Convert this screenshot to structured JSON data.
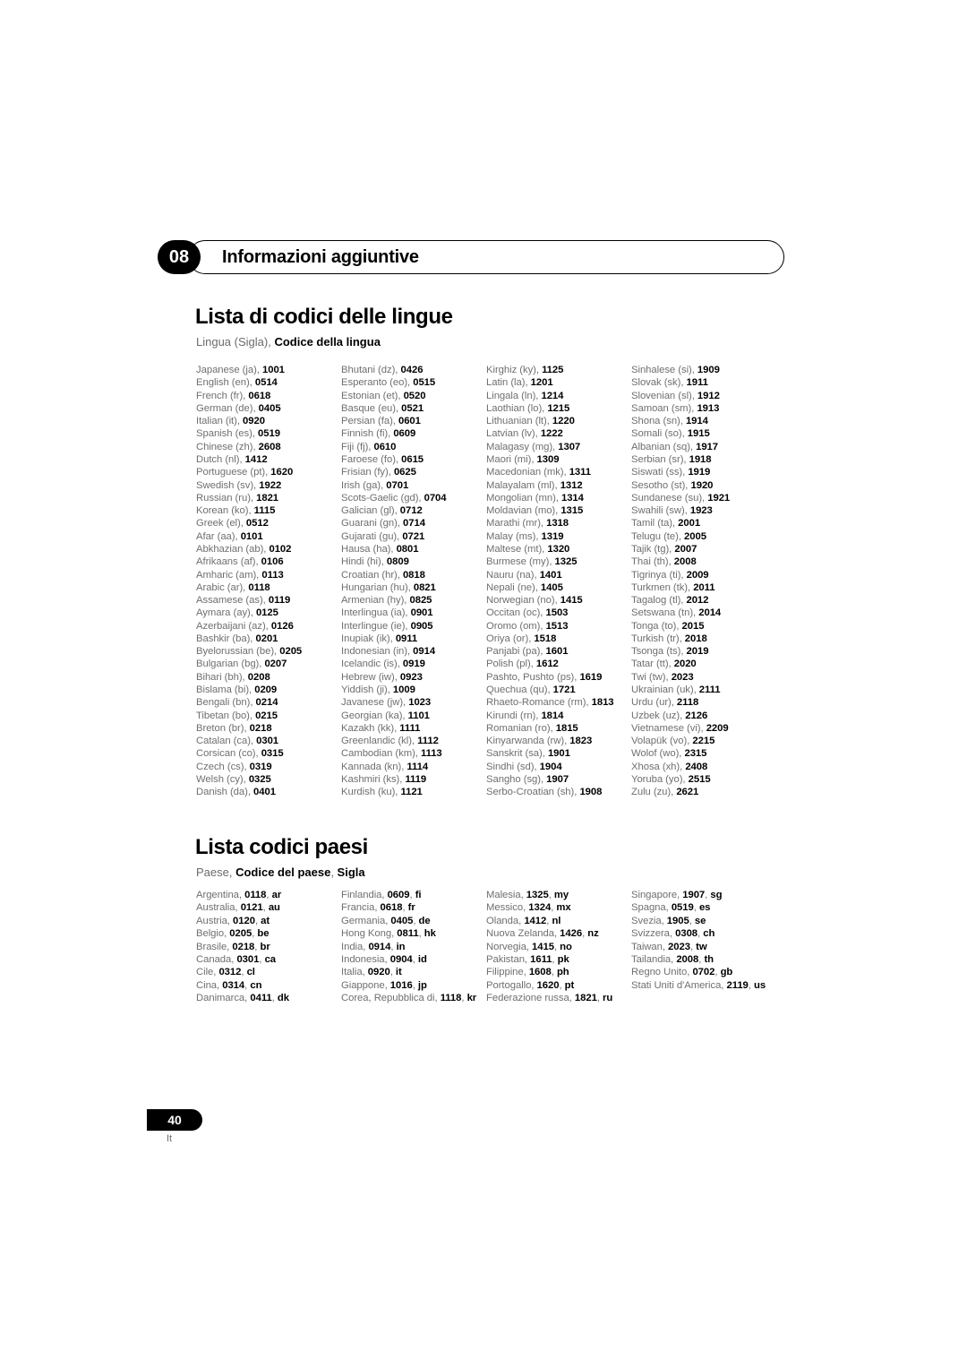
{
  "chapter": {
    "number": "08",
    "title": "Informazioni aggiuntive"
  },
  "language_section": {
    "title": "Lista di codici delle lingue",
    "subtitle_plain": "Lingua (Sigla), ",
    "subtitle_bold": "Codice della lingua"
  },
  "country_section": {
    "title": "Lista codici paesi",
    "subtitle_plain": "Paese, ",
    "subtitle_bold1": "Codice del paese",
    "subtitle_plain2": ", ",
    "subtitle_bold2": "Sigla"
  },
  "language_codes": {
    "columns": [
      [
        {
          "name": "Japanese (ja), ",
          "code": "1001"
        },
        {
          "name": "English (en), ",
          "code": "0514"
        },
        {
          "name": "French (fr), ",
          "code": "0618"
        },
        {
          "name": "German (de), ",
          "code": "0405"
        },
        {
          "name": "Italian (it), ",
          "code": "0920"
        },
        {
          "name": "Spanish (es), ",
          "code": "0519"
        },
        {
          "name": "Chinese (zh), ",
          "code": "2608"
        },
        {
          "name": "Dutch (nl), ",
          "code": "1412"
        },
        {
          "name": "Portuguese (pt), ",
          "code": "1620"
        },
        {
          "name": "Swedish (sv), ",
          "code": "1922"
        },
        {
          "name": "Russian (ru), ",
          "code": "1821"
        },
        {
          "name": "Korean (ko), ",
          "code": "1115"
        },
        {
          "name": "Greek (el), ",
          "code": "0512"
        },
        {
          "name": "Afar (aa), ",
          "code": "0101"
        },
        {
          "name": "Abkhazian (ab), ",
          "code": "0102"
        },
        {
          "name": "Afrikaans (af), ",
          "code": "0106"
        },
        {
          "name": "Amharic (am), ",
          "code": "0113"
        },
        {
          "name": "Arabic (ar), ",
          "code": "0118"
        },
        {
          "name": "Assamese (as), ",
          "code": "0119"
        },
        {
          "name": "Aymara (ay), ",
          "code": "0125"
        },
        {
          "name": "Azerbaijani (az), ",
          "code": "0126"
        },
        {
          "name": "Bashkir (ba), ",
          "code": "0201"
        },
        {
          "name": "Byelorussian (be), ",
          "code": "0205"
        },
        {
          "name": "Bulgarian (bg), ",
          "code": "0207"
        },
        {
          "name": "Bihari (bh), ",
          "code": "0208"
        },
        {
          "name": "Bislama (bi), ",
          "code": "0209"
        },
        {
          "name": "Bengali (bn), ",
          "code": "0214"
        },
        {
          "name": "Tibetan (bo), ",
          "code": "0215"
        },
        {
          "name": "Breton (br), ",
          "code": "0218"
        },
        {
          "name": "Catalan (ca), ",
          "code": "0301"
        },
        {
          "name": "Corsican (co), ",
          "code": "0315"
        },
        {
          "name": "Czech (cs), ",
          "code": "0319"
        },
        {
          "name": "Welsh (cy), ",
          "code": "0325"
        },
        {
          "name": "Danish (da), ",
          "code": "0401"
        }
      ],
      [
        {
          "name": "Bhutani (dz), ",
          "code": "0426"
        },
        {
          "name": "Esperanto (eo), ",
          "code": "0515"
        },
        {
          "name": "Estonian (et), ",
          "code": "0520"
        },
        {
          "name": "Basque (eu), ",
          "code": "0521"
        },
        {
          "name": "Persian (fa), ",
          "code": "0601"
        },
        {
          "name": "Finnish (fi), ",
          "code": "0609"
        },
        {
          "name": "Fiji (fj), ",
          "code": "0610"
        },
        {
          "name": "Faroese (fo), ",
          "code": "0615"
        },
        {
          "name": "Frisian (fy), ",
          "code": "0625"
        },
        {
          "name": "Irish (ga), ",
          "code": "0701"
        },
        {
          "name": "Scots-Gaelic (gd), ",
          "code": "0704"
        },
        {
          "name": "Galician (gl), ",
          "code": "0712"
        },
        {
          "name": "Guarani (gn), ",
          "code": "0714"
        },
        {
          "name": "Gujarati (gu), ",
          "code": "0721"
        },
        {
          "name": "Hausa (ha), ",
          "code": "0801"
        },
        {
          "name": "Hindi (hi), ",
          "code": "0809"
        },
        {
          "name": "Croatian (hr), ",
          "code": "0818"
        },
        {
          "name": "Hungarian (hu), ",
          "code": "0821"
        },
        {
          "name": "Armenian (hy), ",
          "code": "0825"
        },
        {
          "name": "Interlingua (ia), ",
          "code": "0901"
        },
        {
          "name": "Interlingue (ie), ",
          "code": "0905"
        },
        {
          "name": "Inupiak (ik), ",
          "code": "0911"
        },
        {
          "name": "Indonesian (in), ",
          "code": "0914"
        },
        {
          "name": "Icelandic (is), ",
          "code": "0919"
        },
        {
          "name": "Hebrew (iw), ",
          "code": "0923"
        },
        {
          "name": "Yiddish (ji), ",
          "code": "1009"
        },
        {
          "name": "Javanese (jw), ",
          "code": "1023"
        },
        {
          "name": "Georgian (ka), ",
          "code": "1101"
        },
        {
          "name": "Kazakh (kk), ",
          "code": "1111"
        },
        {
          "name": "Greenlandic (kl), ",
          "code": "1112"
        },
        {
          "name": "Cambodian (km), ",
          "code": "1113"
        },
        {
          "name": "Kannada (kn), ",
          "code": "1114"
        },
        {
          "name": "Kashmiri (ks), ",
          "code": "1119"
        },
        {
          "name": "Kurdish (ku), ",
          "code": "1121"
        }
      ],
      [
        {
          "name": "Kirghiz (ky), ",
          "code": "1125"
        },
        {
          "name": "Latin (la), ",
          "code": "1201"
        },
        {
          "name": "Lingala (ln), ",
          "code": "1214"
        },
        {
          "name": "Laothian (lo), ",
          "code": "1215"
        },
        {
          "name": "Lithuanian (lt), ",
          "code": "1220"
        },
        {
          "name": "Latvian (lv), ",
          "code": "1222"
        },
        {
          "name": "Malagasy (mg), ",
          "code": "1307"
        },
        {
          "name": "Maori (mi), ",
          "code": "1309"
        },
        {
          "name": "Macedonian (mk), ",
          "code": "1311"
        },
        {
          "name": "Malayalam (ml), ",
          "code": "1312"
        },
        {
          "name": "Mongolian (mn), ",
          "code": "1314"
        },
        {
          "name": "Moldavian (mo), ",
          "code": "1315"
        },
        {
          "name": "Marathi (mr), ",
          "code": "1318"
        },
        {
          "name": "Malay (ms), ",
          "code": "1319"
        },
        {
          "name": "Maltese (mt), ",
          "code": "1320"
        },
        {
          "name": "Burmese (my), ",
          "code": "1325"
        },
        {
          "name": "Nauru (na), ",
          "code": "1401"
        },
        {
          "name": "Nepali (ne), ",
          "code": "1405"
        },
        {
          "name": "Norwegian (no), ",
          "code": "1415"
        },
        {
          "name": "Occitan (oc), ",
          "code": "1503"
        },
        {
          "name": "Oromo (om), ",
          "code": "1513"
        },
        {
          "name": "Oriya (or), ",
          "code": "1518"
        },
        {
          "name": "Panjabi (pa), ",
          "code": "1601"
        },
        {
          "name": "Polish (pl), ",
          "code": "1612"
        },
        {
          "name": "Pashto, Pushto (ps), ",
          "code": "1619"
        },
        {
          "name": "Quechua (qu), ",
          "code": "1721"
        },
        {
          "name": "Rhaeto-Romance (rm), ",
          "code": "1813"
        },
        {
          "name": "Kirundi (rn), ",
          "code": "1814"
        },
        {
          "name": "Romanian (ro), ",
          "code": "1815"
        },
        {
          "name": "Kinyarwanda (rw), ",
          "code": "1823"
        },
        {
          "name": "Sanskrit (sa), ",
          "code": "1901"
        },
        {
          "name": "Sindhi (sd), ",
          "code": "1904"
        },
        {
          "name": "Sangho (sg), ",
          "code": "1907"
        },
        {
          "name": "Serbo-Croatian (sh), ",
          "code": "1908"
        }
      ],
      [
        {
          "name": "Sinhalese (si), ",
          "code": "1909"
        },
        {
          "name": "Slovak (sk), ",
          "code": "1911"
        },
        {
          "name": "Slovenian (sl), ",
          "code": "1912"
        },
        {
          "name": "Samoan (sm), ",
          "code": "1913"
        },
        {
          "name": "Shona (sn), ",
          "code": "1914"
        },
        {
          "name": "Somali (so), ",
          "code": "1915"
        },
        {
          "name": "Albanian (sq), ",
          "code": "1917"
        },
        {
          "name": "Serbian (sr), ",
          "code": "1918"
        },
        {
          "name": "Siswati (ss), ",
          "code": "1919"
        },
        {
          "name": "Sesotho (st), ",
          "code": "1920"
        },
        {
          "name": "Sundanese (su), ",
          "code": "1921"
        },
        {
          "name": "Swahili (sw), ",
          "code": "1923"
        },
        {
          "name": "Tamil (ta), ",
          "code": "2001"
        },
        {
          "name": "Telugu (te), ",
          "code": "2005"
        },
        {
          "name": "Tajik (tg), ",
          "code": "2007"
        },
        {
          "name": "Thai (th), ",
          "code": "2008"
        },
        {
          "name": "Tigrinya (ti), ",
          "code": "2009"
        },
        {
          "name": "Turkmen (tk), ",
          "code": "2011"
        },
        {
          "name": "Tagalog (tl), ",
          "code": "2012"
        },
        {
          "name": "Setswana (tn), ",
          "code": "2014"
        },
        {
          "name": "Tonga (to), ",
          "code": "2015"
        },
        {
          "name": "Turkish (tr), ",
          "code": "2018"
        },
        {
          "name": "Tsonga (ts), ",
          "code": "2019"
        },
        {
          "name": "Tatar (tt), ",
          "code": "2020"
        },
        {
          "name": "Twi (tw), ",
          "code": "2023"
        },
        {
          "name": "Ukrainian (uk), ",
          "code": "2111"
        },
        {
          "name": "Urdu (ur), ",
          "code": "2118"
        },
        {
          "name": "Uzbek (uz), ",
          "code": "2126"
        },
        {
          "name": "Vietnamese (vi), ",
          "code": "2209"
        },
        {
          "name": "Volapük (vo), ",
          "code": "2215"
        },
        {
          "name": "Wolof (wo), ",
          "code": "2315"
        },
        {
          "name": "Xhosa (xh), ",
          "code": "2408"
        },
        {
          "name": "Yoruba (yo), ",
          "code": "2515"
        },
        {
          "name": "Zulu (zu), ",
          "code": "2621"
        }
      ]
    ]
  },
  "country_codes": {
    "columns": [
      [
        {
          "name": "Argentina, ",
          "code": "0118",
          "abbr": "ar"
        },
        {
          "name": "Australia, ",
          "code": "0121",
          "abbr": "au"
        },
        {
          "name": "Austria, ",
          "code": "0120",
          "abbr": "at"
        },
        {
          "name": "Belgio, ",
          "code": "0205",
          "abbr": "be"
        },
        {
          "name": "Brasile, ",
          "code": "0218",
          "abbr": "br"
        },
        {
          "name": "Canada, ",
          "code": "0301",
          "abbr": "ca"
        },
        {
          "name": "Cile, ",
          "code": "0312",
          "abbr": "cl"
        },
        {
          "name": "Cina, ",
          "code": "0314",
          "abbr": "cn"
        },
        {
          "name": "Danimarca, ",
          "code": "0411",
          "abbr": "dk"
        }
      ],
      [
        {
          "name": "Finlandia, ",
          "code": "0609",
          "abbr": "fi"
        },
        {
          "name": "Francia, ",
          "code": "0618",
          "abbr": "fr"
        },
        {
          "name": "Germania, ",
          "code": "0405",
          "abbr": "de"
        },
        {
          "name": "Hong Kong, ",
          "code": "0811",
          "abbr": "hk"
        },
        {
          "name": "India, ",
          "code": "0914",
          "abbr": "in"
        },
        {
          "name": "Indonesia, ",
          "code": "0904",
          "abbr": "id"
        },
        {
          "name": "Italia, ",
          "code": "0920",
          "abbr": "it"
        },
        {
          "name": "Giappone, ",
          "code": "1016",
          "abbr": "jp"
        },
        {
          "name": "Corea, Repubblica di, ",
          "code": "1118",
          "abbr": "kr"
        }
      ],
      [
        {
          "name": "Malesia, ",
          "code": "1325",
          "abbr": "my"
        },
        {
          "name": "Messico, ",
          "code": "1324",
          "abbr": "mx"
        },
        {
          "name": "Olanda, ",
          "code": "1412",
          "abbr": "nl"
        },
        {
          "name": "Nuova Zelanda, ",
          "code": "1426",
          "abbr": "nz"
        },
        {
          "name": "Norvegia, ",
          "code": "1415",
          "abbr": "no"
        },
        {
          "name": "Pakistan, ",
          "code": "1611",
          "abbr": "pk"
        },
        {
          "name": "Filippine, ",
          "code": "1608",
          "abbr": "ph"
        },
        {
          "name": "Portogallo, ",
          "code": "1620",
          "abbr": "pt"
        },
        {
          "name": "Federazione russa, ",
          "code": "1821",
          "abbr": "ru"
        }
      ],
      [
        {
          "name": "Singapore, ",
          "code": "1907",
          "abbr": "sg"
        },
        {
          "name": "Spagna, ",
          "code": "0519",
          "abbr": "es"
        },
        {
          "name": "Svezia, ",
          "code": "1905",
          "abbr": "se"
        },
        {
          "name": "Svizzera, ",
          "code": "0308",
          "abbr": "ch"
        },
        {
          "name": "Taiwan, ",
          "code": "2023",
          "abbr": "tw"
        },
        {
          "name": "Tailandia, ",
          "code": "2008",
          "abbr": "th"
        },
        {
          "name": "Regno Unito, ",
          "code": "0702",
          "abbr": "gb"
        },
        {
          "name": "Stati Uniti d'America, ",
          "code": "2119",
          "abbr": "us"
        }
      ]
    ]
  },
  "footer": {
    "page_number": "40",
    "language_code": "It"
  }
}
